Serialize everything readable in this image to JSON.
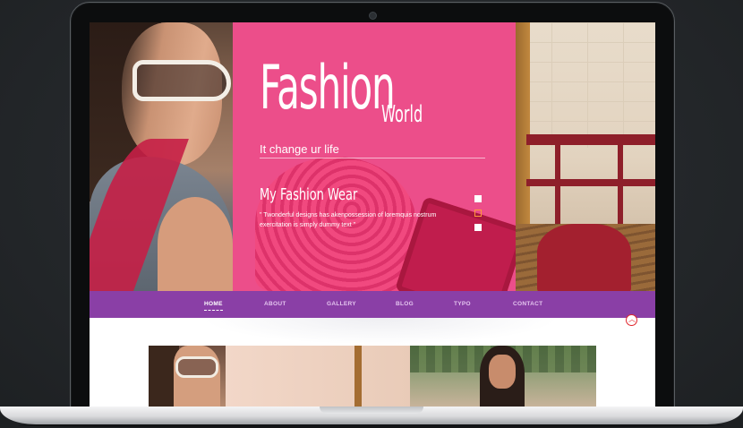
{
  "hero": {
    "brand_main": "Fashion",
    "brand_sub": "World",
    "tagline": "It change ur life",
    "slide_title": "My Fashion Wear",
    "slide_text": "\" Twonderful designs has akenpossession of loremquis nostrum exercitation is simply dummy text \"",
    "slider_dots": 3,
    "active_dot": 2
  },
  "nav": {
    "items": [
      {
        "label": "HOME",
        "active": true
      },
      {
        "label": "ABOUT",
        "active": false
      },
      {
        "label": "GALLERY",
        "active": false
      },
      {
        "label": "BLOG",
        "active": false
      },
      {
        "label": "TYPO",
        "active": false
      },
      {
        "label": "CONTACT",
        "active": false
      }
    ]
  },
  "icons": {
    "scroll_top": "chevron-up-icon"
  },
  "colors": {
    "nav_bg": "#8a3fa6",
    "hero_overlay": "#ec4e8a",
    "scroll_top": "#e0262c"
  }
}
